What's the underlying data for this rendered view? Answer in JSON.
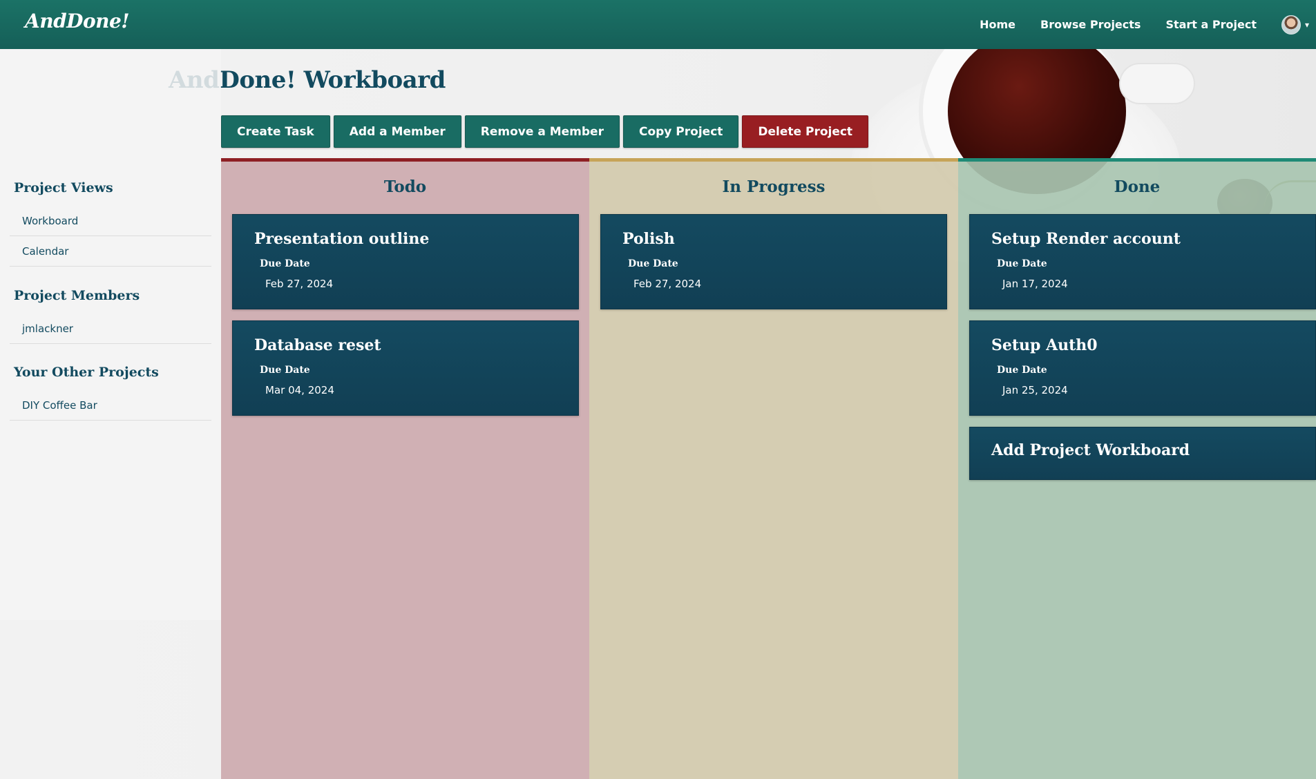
{
  "nav": {
    "brand": "AndDone!",
    "links": [
      "Home",
      "Browse Projects",
      "Start a Project"
    ],
    "avatar_caret": "▾"
  },
  "page": {
    "title": "AndDone! Workboard"
  },
  "actions": {
    "create_task": "Create Task",
    "add_member": "Add a Member",
    "remove_member": "Remove a Member",
    "copy_project": "Copy Project",
    "delete_project": "Delete Project"
  },
  "sidebar": {
    "views_heading": "Project Views",
    "views": [
      "Workboard",
      "Calendar"
    ],
    "members_heading": "Project Members",
    "members": [
      "jmlackner"
    ],
    "other_heading": "Your Other Projects",
    "other_projects": [
      "DIY Coffee Bar"
    ]
  },
  "board": {
    "columns": [
      {
        "title": "Todo",
        "cards": [
          {
            "title": "Presentation outline",
            "due_label": "Due Date",
            "due": "Feb 27, 2024"
          },
          {
            "title": "Database reset",
            "due_label": "Due Date",
            "due": "Mar 04, 2024"
          }
        ]
      },
      {
        "title": "In Progress",
        "cards": [
          {
            "title": "Polish",
            "due_label": "Due Date",
            "due": "Feb 27, 2024"
          }
        ]
      },
      {
        "title": "Done",
        "cards": [
          {
            "title": "Setup Render account",
            "due_label": "Due Date",
            "due": "Jan 17, 2024"
          },
          {
            "title": "Setup Auth0",
            "due_label": "Due Date",
            "due": "Jan 25, 2024"
          },
          {
            "title": "Add Project Workboard"
          }
        ]
      }
    ]
  },
  "colors": {
    "nav_bg": "#196c63",
    "heading_text": "#124a5f",
    "card_bg": "#134660",
    "danger": "#981e22",
    "todo_bg": "#cdaaaf",
    "todo_accent": "#8e1f24",
    "progress_bg": "#d2caac",
    "progress_accent": "#c7a458",
    "done_bg": "#a8c4b0",
    "done_accent": "#1f8a76"
  }
}
